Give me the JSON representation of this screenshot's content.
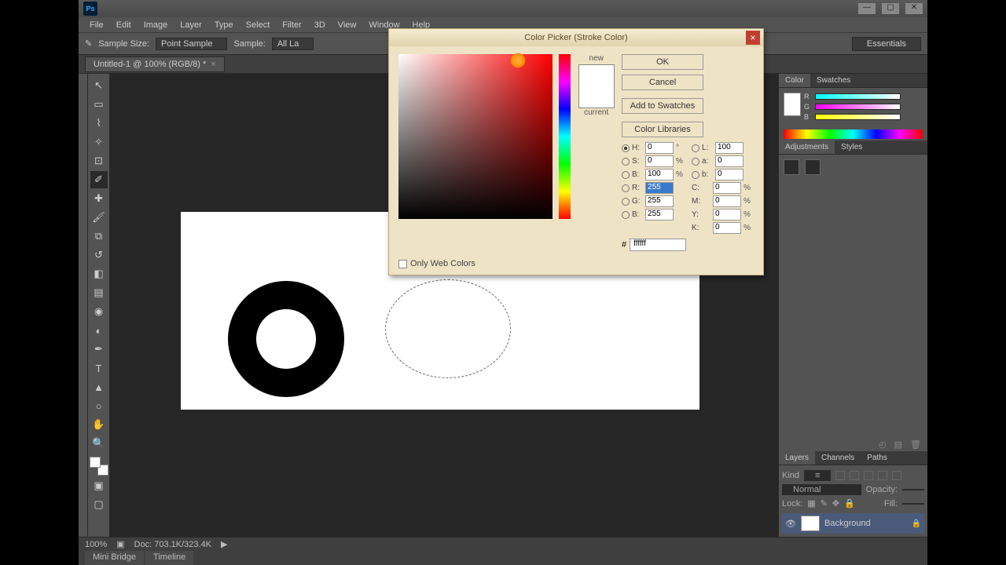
{
  "app": {
    "logo": "Ps"
  },
  "menubar": [
    "File",
    "Edit",
    "Image",
    "Layer",
    "Type",
    "Select",
    "Filter",
    "3D",
    "View",
    "Window",
    "Help"
  ],
  "optionsbar": {
    "sample_size_label": "Sample Size:",
    "sample_size_value": "Point Sample",
    "sample_label": "Sample:",
    "sample_value": "All La",
    "workspace": "Essentials"
  },
  "doc_tab": {
    "title": "Untitled-1 @ 100% (RGB/8) *"
  },
  "statusbar": {
    "zoom": "100%",
    "doc": "Doc: 703.1K/323.4K"
  },
  "bottom_tabs": [
    "Mini Bridge",
    "Timeline"
  ],
  "right": {
    "color_tab": "Color",
    "swatches_tab": "Swatches",
    "adj_tab": "Adjustments",
    "styles_tab": "Styles",
    "layers_tab": "Layers",
    "channels_tab": "Channels",
    "paths_tab": "Paths",
    "kind_label": "Kind",
    "blend": "Normal",
    "opacity_label": "Opacity:",
    "opacity_val": "",
    "lock_label": "Lock:",
    "fill_label": "Fill:",
    "fill_val": "",
    "layer_name": "Background"
  },
  "dialog": {
    "title": "Color Picker (Stroke Color)",
    "new_label": "new",
    "current_label": "current",
    "ok": "OK",
    "cancel": "Cancel",
    "add_swatch": "Add to Swatches",
    "libraries": "Color Libraries",
    "only_web": "Only Web Colors",
    "values": {
      "H": "0",
      "Hu": "°",
      "S": "0",
      "Su": "%",
      "Bv": "100",
      "Bvu": "%",
      "L": "100",
      "a": "0",
      "b": "0",
      "R": "255",
      "G": "255",
      "B": "255",
      "C": "0",
      "Cu": "%",
      "M": "0",
      "Mu": "%",
      "Y": "0",
      "Yu": "%",
      "K": "0",
      "Ku": "%",
      "hex_label": "#",
      "hex": "ffffff"
    }
  }
}
